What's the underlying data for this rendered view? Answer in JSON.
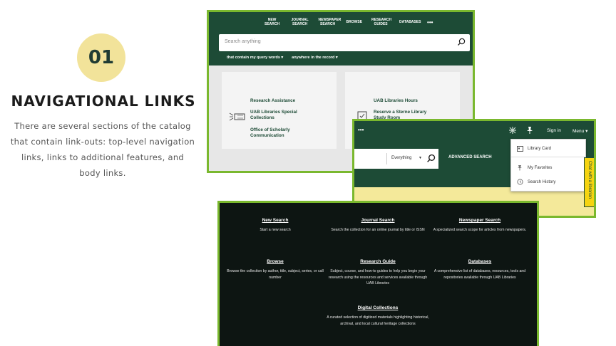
{
  "intro": {
    "number": "01",
    "heading": "NAVIGATIONAL LINKS",
    "body": "There are several sections of the catalog that contain link-outs: top-level navigation links, links to additional features, and body links."
  },
  "shot1": {
    "nav": [
      "NEW SEARCH",
      "JOURNAL SEARCH",
      "NEWSPAPER SEARCH",
      "BROWSE",
      "RESEARCH GUIDES",
      "DATABASES"
    ],
    "more": "•••",
    "search_placeholder": "Search anything",
    "filter1": "that contain my query words",
    "filter2": "anywhere in the record",
    "card1": {
      "link1": "Research Assistance",
      "link2": "UAB Libraries Special Collections",
      "link3": "Office of Scholarly Communication"
    },
    "card2": {
      "link1": "UAB Libraries Hours",
      "link2": "Reserve a Sterne Library Study Room"
    }
  },
  "shot2": {
    "more": "•••",
    "sign_in": "Sign in",
    "menu": "Menu",
    "scope": "Everything",
    "advanced": "ADVANCED SEARCH",
    "dropdown": [
      "Library Card",
      "My Favorites",
      "Search History"
    ],
    "chat": "Chat with a librarian"
  },
  "shot3": {
    "items": [
      {
        "title": "New Search",
        "desc": "Start a new search"
      },
      {
        "title": "Journal Search",
        "desc": "Search the collection for an online journal by title or ISSN"
      },
      {
        "title": "Newspaper Search",
        "desc": "A specialized search scope for articles from newspapers."
      },
      {
        "title": "Browse",
        "desc": "Browse the collection by author, title, subject, series, or call number"
      },
      {
        "title": "Research Guide",
        "desc": "Subject, course, and how-to guides to help you begin your research using the resources and services available through UAB Libraries"
      },
      {
        "title": "Databases",
        "desc": "A comprehensive list of databases, resources, tools and repositories available through UAB Libraries"
      },
      {
        "title": "Digital Collections",
        "desc": "A curated selection of digitized materials highlighting historical, archival, and local cultural heritage collections"
      }
    ]
  },
  "colors": {
    "dark_green": "#1d4b36",
    "lime_border": "#7ab82e",
    "badge_yellow": "#f2e39a",
    "chat_yellow": "#f6d410",
    "dark_bg": "#0d1512"
  }
}
